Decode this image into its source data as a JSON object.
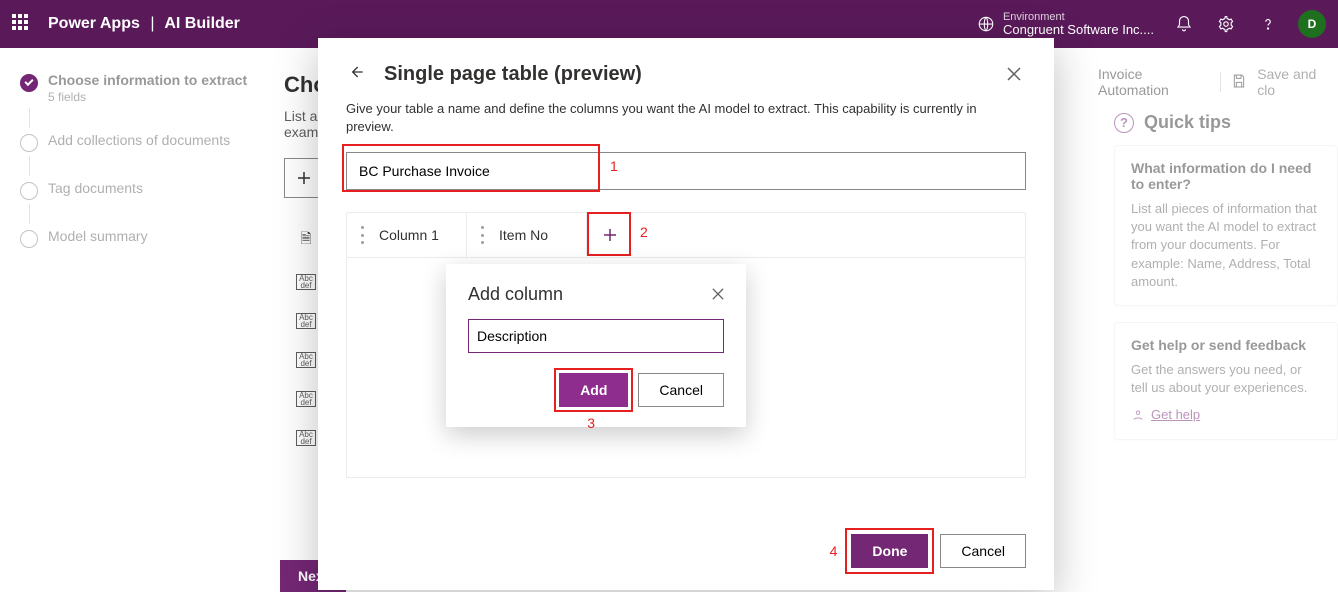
{
  "topbar": {
    "app": "Power Apps",
    "section": "AI Builder",
    "env_label": "Environment",
    "env_value": "Congruent Software Inc....",
    "avatar_initial": "D"
  },
  "toprow": {
    "breadcrumb": "Invoice Automation",
    "save": "Save and clo"
  },
  "steps": {
    "s1_title": "Choose information to extract",
    "s1_sub": "5 fields",
    "s2_title": "Add collections of documents",
    "s3_title": "Tag documents",
    "s4_title": "Model summary"
  },
  "main": {
    "heading_trunc": "Cho",
    "lead_l1": "List a",
    "lead_l2": "exam",
    "next": "Next"
  },
  "fields": [
    {
      "icon": "doc",
      "name": ""
    },
    {
      "icon": "abc",
      "name": ""
    },
    {
      "icon": "abc",
      "name": ""
    },
    {
      "icon": "abc",
      "name": ""
    },
    {
      "icon": "abc",
      "name": ""
    },
    {
      "icon": "abc",
      "name": ""
    }
  ],
  "tips": {
    "head": "Quick tips",
    "c1_title": "What information do I need to enter?",
    "c1_body": "List all pieces of information that you want the AI model to extract from your documents. For example: Name, Address, Total amount.",
    "c2_title": "Get help or send feedback",
    "c2_body": "Get the answers you need, or tell us about your experiences.",
    "c2_link": "Get help"
  },
  "modal": {
    "title": "Single page table (preview)",
    "desc": "Give your table a name and define the columns you want the AI model to extract. This capability is currently in preview.",
    "table_name": "BC Purchase Invoice",
    "col1": "Column 1",
    "col2": "Item No",
    "popover_title": "Add column",
    "col_input": "Description",
    "add": "Add",
    "cancel": "Cancel",
    "done": "Done",
    "cancel2": "Cancel"
  },
  "annot": {
    "n1": "1",
    "n2": "2",
    "n3": "3",
    "n4": "4"
  }
}
